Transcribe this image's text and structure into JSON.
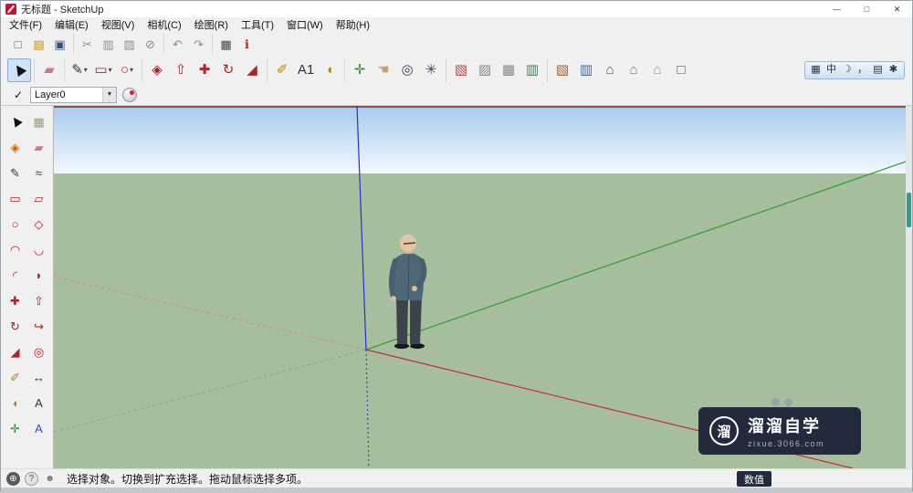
{
  "window": {
    "title": "无标题 - SketchUp",
    "minimize": "—",
    "maximize": "□",
    "close": "✕"
  },
  "ui": {
    "dropdown_arrow": "▾",
    "combo_arrow": "▼"
  },
  "menu_items": [
    {
      "id": "file",
      "label": "文件(F)"
    },
    {
      "id": "edit",
      "label": "编辑(E)"
    },
    {
      "id": "view",
      "label": "视图(V)"
    },
    {
      "id": "camera",
      "label": "相机(C)"
    },
    {
      "id": "draw",
      "label": "绘图(R)"
    },
    {
      "id": "tools",
      "label": "工具(T)"
    },
    {
      "id": "window",
      "label": "窗口(W)"
    },
    {
      "id": "help",
      "label": "帮助(H)"
    }
  ],
  "standard_toolbar": [
    {
      "buttons": [
        {
          "name": "new",
          "glyph": "□",
          "color": "#3c7a3c"
        },
        {
          "name": "open",
          "glyph": "▤",
          "color": "#c09020"
        },
        {
          "name": "save",
          "glyph": "▣",
          "color": "#35507a"
        }
      ]
    },
    {
      "buttons": [
        {
          "name": "cut",
          "glyph": "✂",
          "color": "#8a8f94"
        },
        {
          "name": "copy",
          "glyph": "▥",
          "color": "#8a8f94"
        },
        {
          "name": "paste",
          "glyph": "▨",
          "color": "#8a8f94"
        },
        {
          "name": "erase",
          "glyph": "⊘",
          "color": "#8a8f94"
        }
      ]
    },
    {
      "buttons": [
        {
          "name": "undo",
          "glyph": "↶",
          "color": "#8a8f94"
        },
        {
          "name": "redo",
          "glyph": "↷",
          "color": "#8a8f94"
        }
      ]
    },
    {
      "buttons": [
        {
          "name": "print",
          "glyph": "▦",
          "color": "#444444"
        },
        {
          "name": "model-info",
          "glyph": "ℹ",
          "color": "#c02222"
        }
      ]
    }
  ],
  "main_toolbar": [
    {
      "buttons": [
        {
          "name": "select",
          "glyph": "▶",
          "color": "#111111",
          "pressed": true
        }
      ]
    },
    {
      "buttons": [
        {
          "name": "eraser",
          "glyph": "▰",
          "color": "#c87b8e"
        }
      ]
    },
    {
      "buttons": [
        {
          "name": "line",
          "glyph": "✎",
          "color": "#333333",
          "dropdown": true
        },
        {
          "name": "rectangle",
          "glyph": "▭",
          "color": "#b22222",
          "dropdown": true
        },
        {
          "name": "circle",
          "glyph": "○",
          "color": "#b22222",
          "dropdown": true
        }
      ]
    },
    {
      "buttons": [
        {
          "name": "paint-bucket",
          "glyph": "◈",
          "color": "#b22222"
        },
        {
          "name": "push-pull",
          "glyph": "⇧",
          "color": "#b22222"
        },
        {
          "name": "move",
          "glyph": "✚",
          "color": "#b22222"
        },
        {
          "name": "rotate",
          "glyph": "↻",
          "color": "#b22222"
        },
        {
          "name": "scale",
          "glyph": "◢",
          "color": "#b22222"
        }
      ]
    },
    {
      "buttons": [
        {
          "name": "tape-measure",
          "glyph": "✐",
          "color": "#b8860b"
        },
        {
          "name": "text",
          "glyph": "A1",
          "color": "#333333"
        },
        {
          "name": "protractor",
          "glyph": "◖",
          "color": "#b8860b"
        }
      ]
    },
    {
      "buttons": [
        {
          "name": "axes",
          "glyph": "✛",
          "color": "#2a8a2a"
        },
        {
          "name": "look-around",
          "glyph": "☚",
          "color": "#c8a06a"
        },
        {
          "name": "zoom",
          "glyph": "◎",
          "color": "#334466"
        },
        {
          "name": "zoom-extents",
          "glyph": "✳",
          "color": "#334466"
        }
      ]
    },
    {
      "buttons": [
        {
          "name": "section-plane",
          "glyph": "▧",
          "color": "#c04444"
        },
        {
          "name": "section-display-cuts",
          "glyph": "▨",
          "color": "#888888"
        },
        {
          "name": "section-display-planes",
          "glyph": "▩",
          "color": "#888888"
        },
        {
          "name": "section-fill",
          "glyph": "▥",
          "color": "#4a7a5a"
        }
      ]
    },
    {
      "buttons": [
        {
          "name": "warehouse-box",
          "glyph": "▧",
          "color": "#a0622d"
        },
        {
          "name": "component-book",
          "glyph": "▥",
          "color": "#2d6aa0"
        },
        {
          "name": "house-1",
          "glyph": "⌂",
          "color": "#555555"
        },
        {
          "name": "house-2",
          "glyph": "⌂",
          "color": "#777777"
        },
        {
          "name": "house-3",
          "glyph": "⌂",
          "color": "#999999"
        },
        {
          "name": "crate",
          "glyph": "□",
          "color": "#555555"
        }
      ]
    }
  ],
  "ime_bar": [
    {
      "name": "ime-grid",
      "glyph": "▦"
    },
    {
      "name": "ime-mode",
      "glyph": "中"
    },
    {
      "name": "ime-halfwidth",
      "glyph": "☽"
    },
    {
      "name": "ime-punct",
      "glyph": "，"
    },
    {
      "name": "ime-keyboard",
      "glyph": "▤"
    },
    {
      "name": "ime-tools",
      "glyph": "✱"
    }
  ],
  "layer_toolbar": {
    "check_glyph": "✓",
    "current_layer": "Layer0"
  },
  "tool_palette": [
    {
      "name": "select",
      "glyph": "▶",
      "color": "#111111"
    },
    {
      "name": "make-component",
      "glyph": "▦",
      "color": "#88aa66"
    },
    {
      "name": "paint-bucket",
      "glyph": "◈",
      "color": "#cc6600"
    },
    {
      "name": "eraser",
      "glyph": "▰",
      "color": "#c87b8e"
    },
    {
      "name": "line",
      "glyph": "✎",
      "color": "#333333"
    },
    {
      "name": "freehand",
      "glyph": "≈",
      "color": "#333333"
    },
    {
      "name": "rectangle",
      "glyph": "▭",
      "color": "#b22222"
    },
    {
      "name": "rotated-rectangle",
      "glyph": "▱",
      "color": "#b22222"
    },
    {
      "name": "circle",
      "glyph": "○",
      "color": "#b22222"
    },
    {
      "name": "polygon",
      "glyph": "◇",
      "color": "#b22222"
    },
    {
      "name": "arc",
      "glyph": "◠",
      "color": "#b22222"
    },
    {
      "name": "two-point-arc",
      "glyph": "◡",
      "color": "#b22222"
    },
    {
      "name": "three-point-arc",
      "glyph": "◜",
      "color": "#b22222"
    },
    {
      "name": "pie",
      "glyph": "◗",
      "color": "#b22222"
    },
    {
      "name": "move",
      "glyph": "✚",
      "color": "#b22222"
    },
    {
      "name": "push-pull",
      "glyph": "⇧",
      "color": "#b22222"
    },
    {
      "name": "rotate",
      "glyph": "↻",
      "color": "#b22222"
    },
    {
      "name": "follow-me",
      "glyph": "↪",
      "color": "#b22222"
    },
    {
      "name": "scale",
      "glyph": "◢",
      "color": "#b22222"
    },
    {
      "name": "offset",
      "glyph": "◎",
      "color": "#b22222"
    },
    {
      "name": "tape-measure",
      "glyph": "✐",
      "color": "#b8860b"
    },
    {
      "name": "dimensions",
      "glyph": "↔",
      "color": "#333333"
    },
    {
      "name": "protractor",
      "glyph": "◖",
      "color": "#b8860b"
    },
    {
      "name": "text-tool",
      "glyph": "A",
      "color": "#333333"
    },
    {
      "name": "axes",
      "glyph": "✛",
      "color": "#2a8a2a"
    },
    {
      "name": "3d-text",
      "glyph": "A",
      "color": "#2255cc"
    }
  ],
  "viewport": {
    "colors": {
      "sky_top": "#a7c9ec",
      "sky_horizon": "#f3f9fe",
      "ground": "#a6bd9e",
      "axis_blue": "#2233cc",
      "axis_green": "#2f9e2f",
      "axis_red": "#c03030",
      "axis_green_back": "#86a886",
      "axis_red_back": "#c89084"
    }
  },
  "watermark": {
    "logo_glyph": "溜",
    "title": "溜溜自学",
    "url": "zixue.3066.com"
  },
  "status_bar": {
    "icons": [
      {
        "name": "status-globe-icon",
        "glyph": "⊕",
        "color": "#ffffff",
        "bg": "#5a5a5a"
      },
      {
        "name": "status-help-icon",
        "glyph": "?",
        "color": "#555555",
        "bg": "#e3e3e3",
        "border": "#999999"
      },
      {
        "name": "status-user-icon",
        "glyph": "☻",
        "color": "#777777",
        "bg": "transparent"
      }
    ],
    "message": "选择对象。切换到扩充选择。拖动鼠标选择多项。",
    "measurement_label": "数值"
  }
}
